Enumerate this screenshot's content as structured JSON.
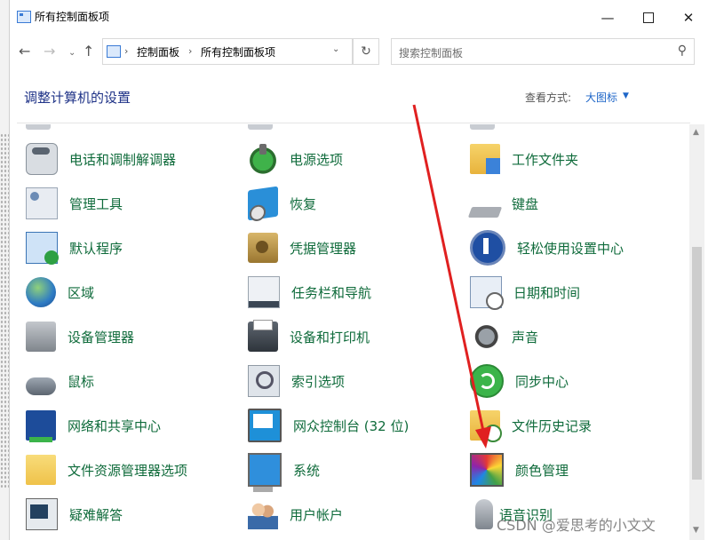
{
  "window": {
    "title": "所有控制面板项",
    "minimize_glyph": "—",
    "close_glyph": "✕"
  },
  "nav": {
    "back_glyph": "←",
    "forward_glyph": "→",
    "recent_glyph": "⌄",
    "up_glyph": "↑",
    "breadcrumb": [
      "控制面板",
      "所有控制面板项"
    ],
    "separator_glyph": "›",
    "dropdown_glyph": "⌄",
    "refresh_glyph": "↻",
    "search_placeholder": "搜索控制面板",
    "search_glyph": "⚲"
  },
  "header": {
    "title": "调整计算机的设置",
    "view_by_label": "查看方式:",
    "view_by_value": "大图标",
    "view_by_caret": "▼"
  },
  "items": [
    {
      "label": "电话和调制解调器",
      "icon": "phone-modem-icon"
    },
    {
      "label": "电源选项",
      "icon": "power-options-icon"
    },
    {
      "label": "工作文件夹",
      "icon": "work-folders-icon"
    },
    {
      "label": "管理工具",
      "icon": "admin-tools-icon"
    },
    {
      "label": "恢复",
      "icon": "recovery-icon"
    },
    {
      "label": "键盘",
      "icon": "keyboard-icon"
    },
    {
      "label": "默认程序",
      "icon": "default-programs-icon"
    },
    {
      "label": "凭据管理器",
      "icon": "credential-manager-icon"
    },
    {
      "label": "轻松使用设置中心",
      "icon": "ease-of-access-icon"
    },
    {
      "label": "区域",
      "icon": "region-icon"
    },
    {
      "label": "任务栏和导航",
      "icon": "taskbar-icon"
    },
    {
      "label": "日期和时间",
      "icon": "date-time-icon"
    },
    {
      "label": "设备管理器",
      "icon": "device-manager-icon"
    },
    {
      "label": "设备和打印机",
      "icon": "devices-printers-icon"
    },
    {
      "label": "声音",
      "icon": "sound-icon"
    },
    {
      "label": "鼠标",
      "icon": "mouse-icon"
    },
    {
      "label": "索引选项",
      "icon": "indexing-options-icon"
    },
    {
      "label": "同步中心",
      "icon": "sync-center-icon"
    },
    {
      "label": "网络和共享中心",
      "icon": "network-sharing-icon"
    },
    {
      "label": "网众控制台 (32 位)",
      "icon": "console-icon"
    },
    {
      "label": "文件历史记录",
      "icon": "file-history-icon"
    },
    {
      "label": "文件资源管理器选项",
      "icon": "explorer-options-icon"
    },
    {
      "label": "系统",
      "icon": "system-icon"
    },
    {
      "label": "颜色管理",
      "icon": "color-management-icon"
    },
    {
      "label": "疑难解答",
      "icon": "troubleshooting-icon"
    },
    {
      "label": "用户帐户",
      "icon": "user-accounts-icon"
    },
    {
      "label": "语音识别",
      "icon": "speech-recognition-icon"
    }
  ],
  "scrollbar": {
    "up_glyph": "▲",
    "down_glyph": "▼"
  },
  "annotation": {
    "arrow_color": "#e02020"
  },
  "watermark": "CSDN @爱思考的小文文",
  "colors": {
    "item_text": "#0f6b3b",
    "heading": "#1e3287",
    "link": "#1e66c8"
  }
}
